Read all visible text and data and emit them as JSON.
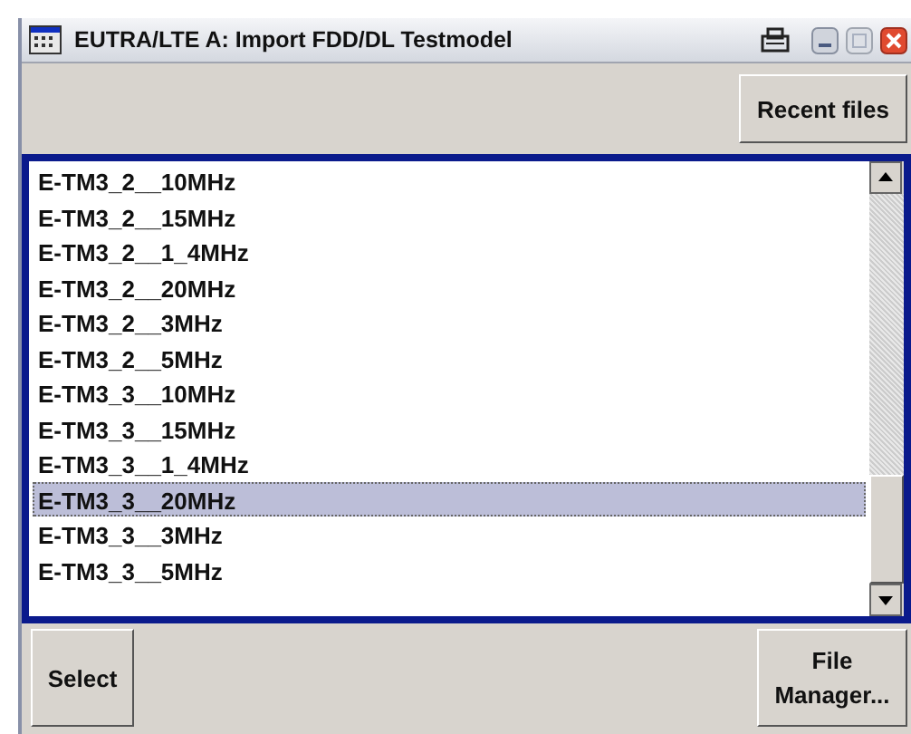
{
  "window": {
    "title": "EUTRA/LTE A: Import FDD/DL Testmodel"
  },
  "toolbar": {
    "recent_files_button": "Recent files"
  },
  "file_list": {
    "items": [
      {
        "label": "E-TM3_2__10MHz",
        "selected": false
      },
      {
        "label": "E-TM3_2__15MHz",
        "selected": false
      },
      {
        "label": "E-TM3_2__1_4MHz",
        "selected": false
      },
      {
        "label": "E-TM3_2__20MHz",
        "selected": false
      },
      {
        "label": "E-TM3_2__3MHz",
        "selected": false
      },
      {
        "label": "E-TM3_2__5MHz",
        "selected": false
      },
      {
        "label": "E-TM3_3__10MHz",
        "selected": false
      },
      {
        "label": "E-TM3_3__15MHz",
        "selected": false
      },
      {
        "label": "E-TM3_3__1_4MHz",
        "selected": false
      },
      {
        "label": "E-TM3_3__20MHz",
        "selected": true
      },
      {
        "label": "E-TM3_3__3MHz",
        "selected": false
      },
      {
        "label": "E-TM3_3__5MHz",
        "selected": false
      }
    ]
  },
  "buttons": {
    "select": "Select",
    "file_manager": "File Manager..."
  }
}
